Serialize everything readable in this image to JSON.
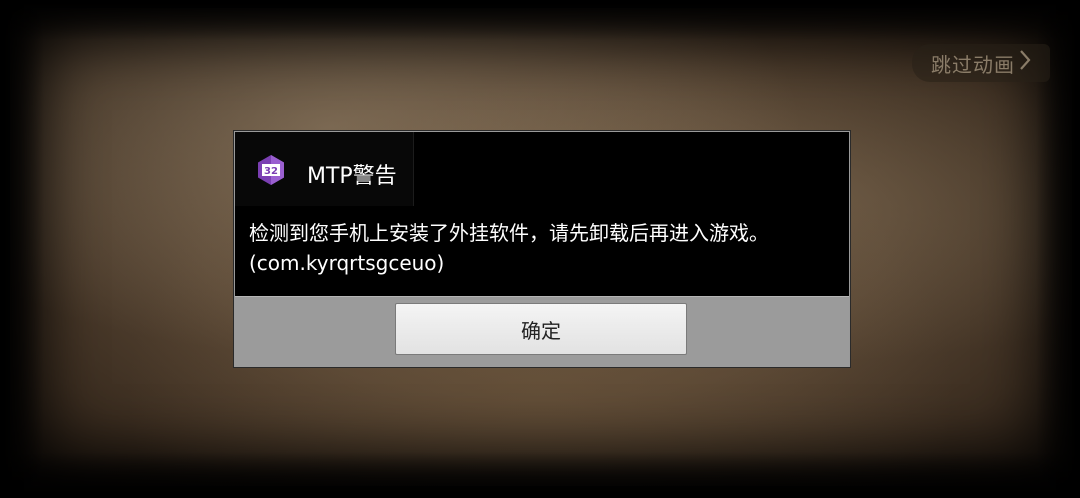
{
  "skip_button": {
    "label": "跳过动画",
    "icon": "chevron-right-icon"
  },
  "dialog": {
    "app_icon": "gameguardian-hexagon-icon",
    "icon_badge_text": "32",
    "title": "MTP警告",
    "message_line1": "检测到您手机上安装了外挂软件，请先卸载后再进入游戏。",
    "message_line2": "(com.kyrqrtsgceuo)",
    "confirm_label": "确定"
  },
  "colors": {
    "dialog_background": "#000000",
    "footer_background": "#9b9b9b",
    "icon_purple": "#7b3fb3",
    "parchment": "#574533"
  }
}
